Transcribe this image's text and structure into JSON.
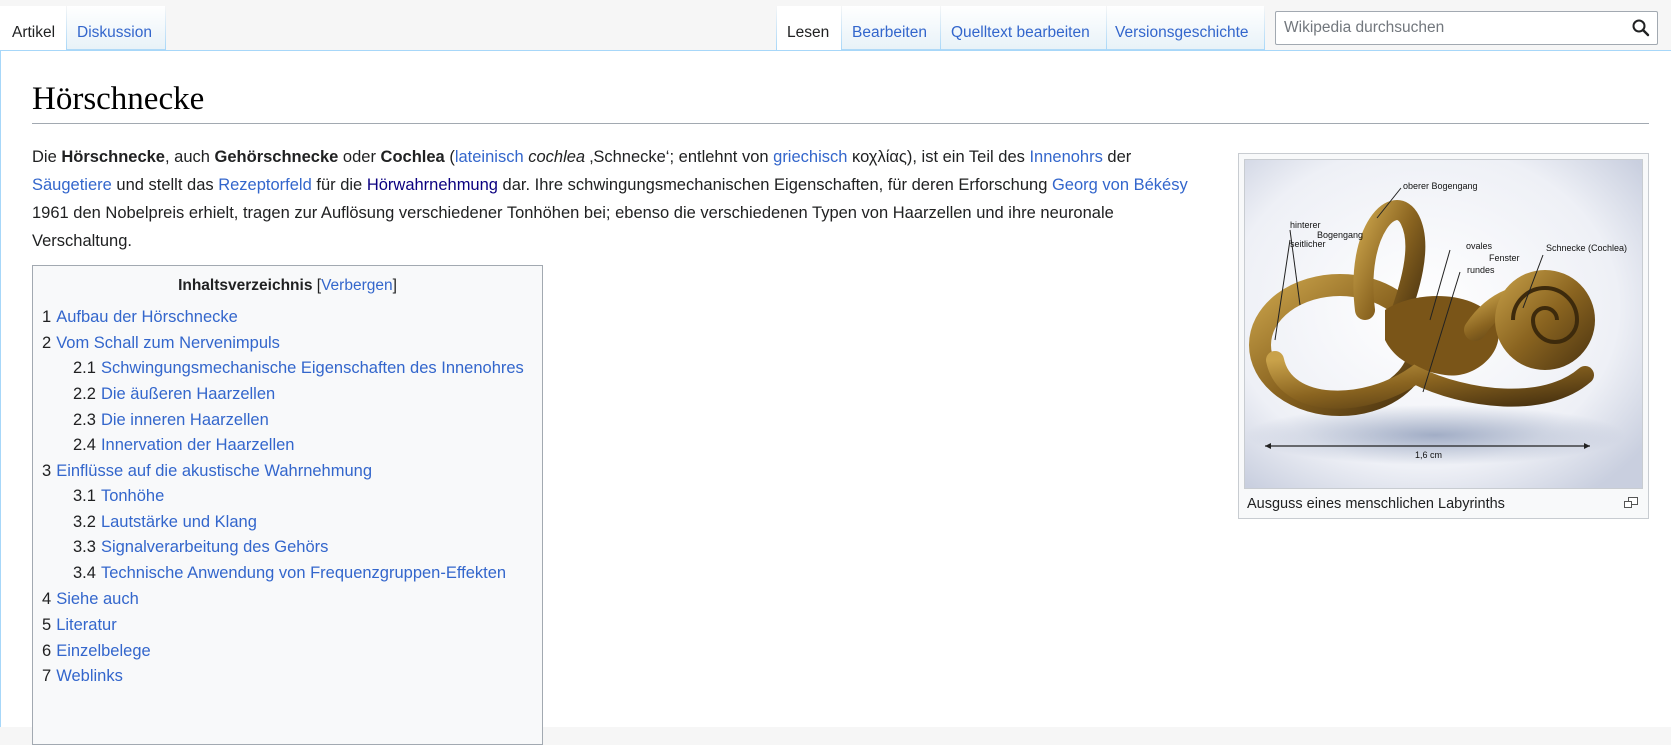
{
  "tabs": {
    "left": [
      "Artikel",
      "Diskussion"
    ],
    "right": [
      "Lesen",
      "Bearbeiten",
      "Quelltext bearbeiten",
      "Versionsgeschichte"
    ]
  },
  "search": {
    "placeholder": "Wikipedia durchsuchen"
  },
  "title": "Hörschnecke",
  "intro": {
    "p1": "Die ",
    "b1": "Hörschnecke",
    "p2": ", auch ",
    "b2": "Gehörschnecke",
    "p3": " oder ",
    "b3": "Cochlea",
    "p4": " (",
    "l1": "lateinisch",
    "i1": "cochlea",
    "p5": " ‚Schnecke‘; entlehnt von ",
    "l2": "griechisch",
    "p6": " κοχλίας), ist ein Teil des ",
    "l3": "Innenohrs",
    "p7": " der ",
    "l4": "Säugetiere",
    "p8": " und stellt das ",
    "l5": "Rezeptorfeld",
    "p9": " für die ",
    "l6": "Hörwahrnehmung",
    "p10": " dar. Ihre schwingungsmechanischen Eigenschaften, für deren Erforschung ",
    "l7": "Georg von Békésy",
    "p11": " 1961 den Nobelpreis erhielt, tragen zur Auflösung verschiedener Tonhöhen bei; ebenso die verschiedenen Typen von Haarzellen und ihre neuronale Verschaltung."
  },
  "thumb": {
    "caption": "Ausguss eines menschlichen Labyrinths",
    "labels": {
      "oberer": "oberer Bogengang",
      "hinterer": "hinterer",
      "bogengang": "Bogengang",
      "seitlicher": "seitlicher",
      "ovales": "ovales",
      "fenster": "Fenster",
      "rundes": "rundes",
      "schnecke": "Schnecke (Cochlea)",
      "scale": "1,6 cm"
    }
  },
  "toc": {
    "title": "Inhaltsverzeichnis",
    "bracket_open": "[",
    "toggle": "Verbergen",
    "bracket_close": "]",
    "items": [
      {
        "num": "1",
        "text": "Aufbau der Hörschnecke"
      },
      {
        "num": "2",
        "text": "Vom Schall zum Nervenimpuls"
      },
      {
        "num": "2.1",
        "text": "Schwingungsmechanische Eigenschaften des Innenohres"
      },
      {
        "num": "2.2",
        "text": "Die äußeren Haarzellen"
      },
      {
        "num": "2.3",
        "text": "Die inneren Haarzellen"
      },
      {
        "num": "2.4",
        "text": "Innervation der Haarzellen"
      },
      {
        "num": "3",
        "text": "Einflüsse auf die akustische Wahrnehmung"
      },
      {
        "num": "3.1",
        "text": "Tonhöhe"
      },
      {
        "num": "3.2",
        "text": "Lautstärke und Klang"
      },
      {
        "num": "3.3",
        "text": "Signalverarbeitung des Gehörs"
      },
      {
        "num": "3.4",
        "text": "Technische Anwendung von Frequenzgruppen-Effekten"
      },
      {
        "num": "4",
        "text": "Siehe auch"
      },
      {
        "num": "5",
        "text": "Literatur"
      },
      {
        "num": "6",
        "text": "Einzelbelege"
      },
      {
        "num": "7",
        "text": "Weblinks"
      }
    ]
  },
  "icons": {
    "search": "search-icon",
    "magnify": "magnify-icon"
  },
  "colors": {
    "link": "#3366cc",
    "visited": "#0b0080",
    "text": "#202122",
    "border": "#a2a9b1",
    "tab_border": "#a7d7f9"
  }
}
